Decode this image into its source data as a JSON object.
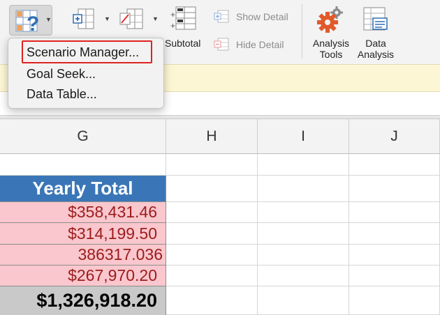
{
  "ribbon": {
    "subtotal_label": "Subtotal",
    "show_detail_label": "Show Detail",
    "hide_detail_label": "Hide Detail",
    "analysis_tools_line1": "Analysis",
    "analysis_tools_line2": "Tools",
    "data_analysis_line1": "Data",
    "data_analysis_line2": "Analysis"
  },
  "whatif_menu": {
    "items": [
      {
        "label": "Scenario Manager...",
        "highlighted": true
      },
      {
        "label": "Goal Seek..."
      },
      {
        "label": "Data Table..."
      }
    ],
    "highlight_color": "#e0221f"
  },
  "columns": [
    "G",
    "H",
    "I",
    "J"
  ],
  "sheet": {
    "header": "Yearly Total",
    "values": [
      "$358,431.46",
      "$314,199.50",
      "386317.036",
      "$267,970.20"
    ],
    "total": "$1,326,918.20"
  },
  "colors": {
    "header_fill": "#3a76b7",
    "value_fill": "#f9c7cd",
    "value_text": "#9c1c1c",
    "total_fill": "#c9c9c9",
    "infobar_fill": "#fdf6d4"
  },
  "icons": [
    "what-if-analysis-icon",
    "group-icon",
    "ungroup-icon",
    "subtotal-icon",
    "show-detail-icon",
    "hide-detail-icon",
    "analysis-tools-gear-icon",
    "data-analysis-icon"
  ]
}
